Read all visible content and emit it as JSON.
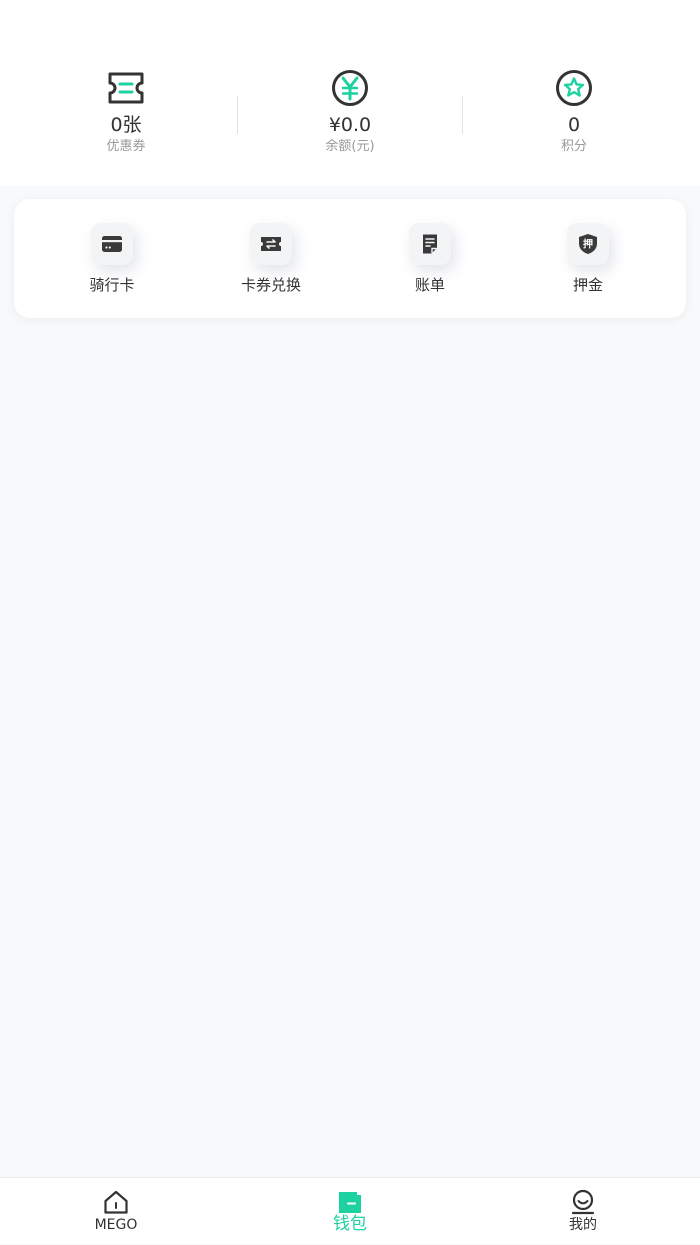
{
  "colors": {
    "accent": "#1dd1a1",
    "icon_dark": "#333333",
    "text_primary": "#333333",
    "text_secondary": "#999999",
    "background": "#f8f9fa"
  },
  "stats": [
    {
      "icon": "coupon-icon",
      "value": "0张",
      "label": "优惠券"
    },
    {
      "icon": "yuan-icon",
      "value": "¥0.0",
      "label": "余额(元)"
    },
    {
      "icon": "star-icon",
      "value": "0",
      "label": "积分"
    }
  ],
  "actions": [
    {
      "icon": "card-icon",
      "label": "骑行卡"
    },
    {
      "icon": "exchange-icon",
      "label": "卡券兑换"
    },
    {
      "icon": "bill-icon",
      "label": "账单"
    },
    {
      "icon": "deposit-shield-icon",
      "label": "押金",
      "glyph": "押"
    }
  ],
  "tabs": [
    {
      "icon": "home-icon",
      "label": "MEGO",
      "active": false
    },
    {
      "icon": "wallet-icon",
      "label": "钱包",
      "active": true
    },
    {
      "icon": "profile-icon",
      "label": "我的",
      "active": false
    }
  ]
}
